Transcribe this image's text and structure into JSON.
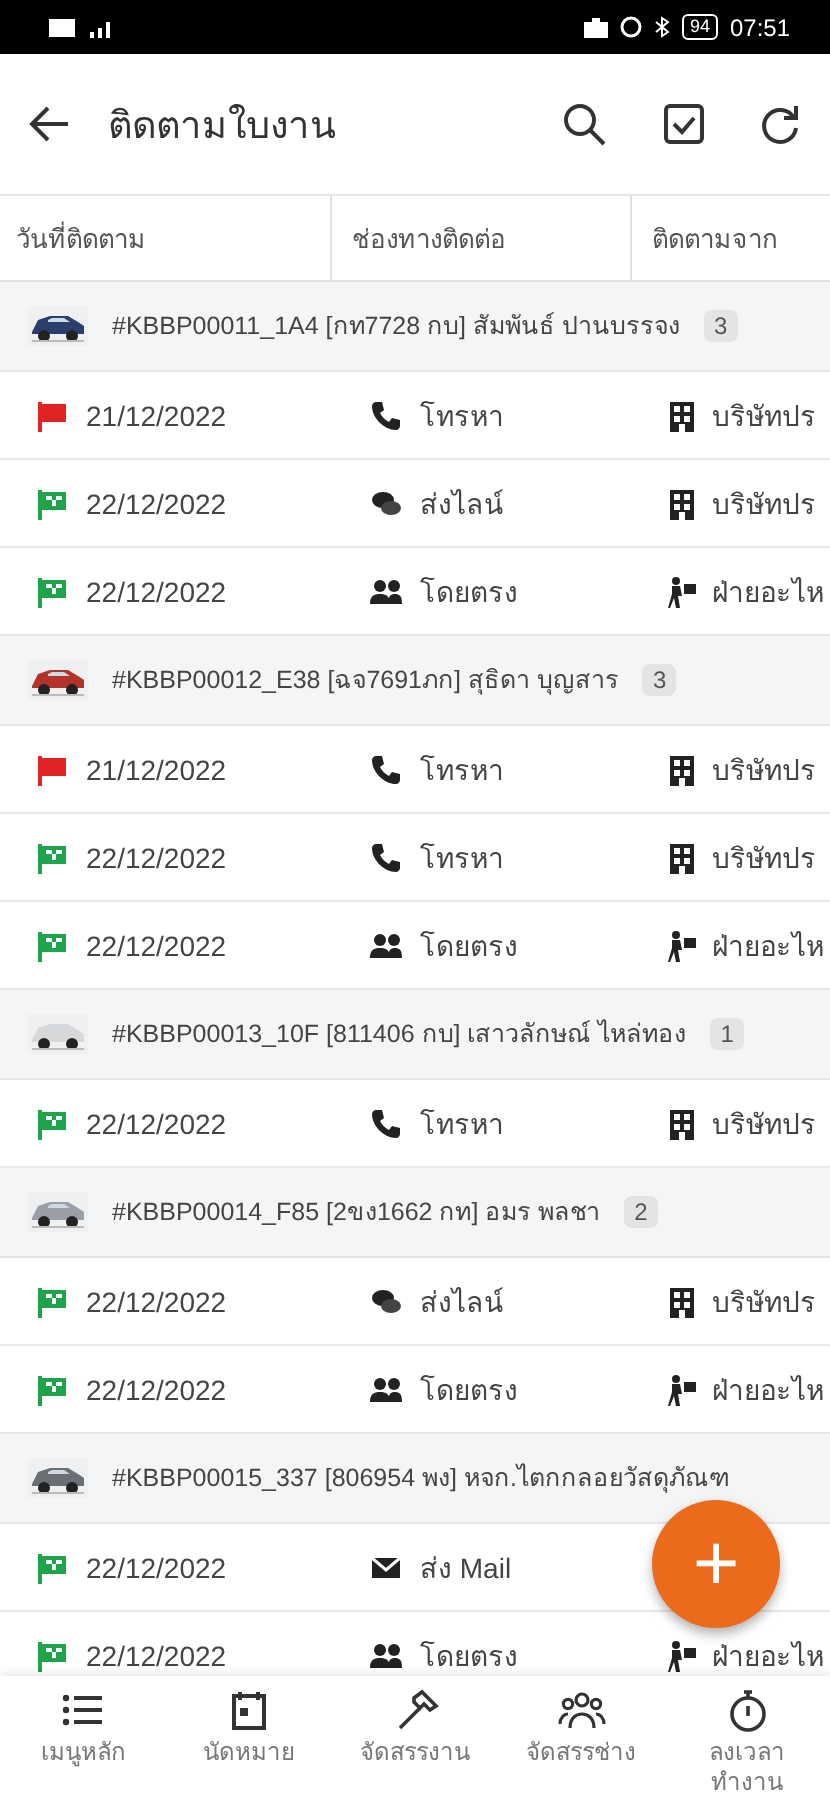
{
  "status_bar": {
    "battery": "94",
    "time": "07:51"
  },
  "app_bar": {
    "title": "ติดตามใบงาน"
  },
  "columns": [
    "วันที่ติดตาม",
    "ช่องทางติดต่อ",
    "ติดตามจาก"
  ],
  "groups": [
    {
      "title": "#KBBP00011_1A4 [กท7728 กบ] สัมพันธ์ ปานบรรจง",
      "count": "3",
      "items": [
        {
          "done": false,
          "date": "21/12/2022",
          "channel": {
            "kind": "phone",
            "text": "โทรหา"
          },
          "source": {
            "kind": "company",
            "text": "บริษัทปร"
          }
        },
        {
          "done": true,
          "date": "22/12/2022",
          "channel": {
            "kind": "chat",
            "text": "ส่งไลน์"
          },
          "source": {
            "kind": "company",
            "text": "บริษัทปร"
          }
        },
        {
          "done": true,
          "date": "22/12/2022",
          "channel": {
            "kind": "people",
            "text": "โดยตรง"
          },
          "source": {
            "kind": "parts",
            "text": "ฝ่ายอะไห"
          }
        }
      ]
    },
    {
      "title": "#KBBP00012_E38 [ฉจ7691ภก] สุธิดา บุญสาร",
      "count": "3",
      "items": [
        {
          "done": false,
          "date": "21/12/2022",
          "channel": {
            "kind": "phone",
            "text": "โทรหา"
          },
          "source": {
            "kind": "company",
            "text": "บริษัทปร"
          }
        },
        {
          "done": true,
          "date": "22/12/2022",
          "channel": {
            "kind": "phone",
            "text": "โทรหา"
          },
          "source": {
            "kind": "company",
            "text": "บริษัทปร"
          }
        },
        {
          "done": true,
          "date": "22/12/2022",
          "channel": {
            "kind": "people",
            "text": "โดยตรง"
          },
          "source": {
            "kind": "parts",
            "text": "ฝ่ายอะไห"
          }
        }
      ]
    },
    {
      "title": "#KBBP00013_10F [811406 กบ] เสาวลักษณ์ ไหล่ทอง",
      "count": "1",
      "items": [
        {
          "done": true,
          "date": "22/12/2022",
          "channel": {
            "kind": "phone",
            "text": "โทรหา"
          },
          "source": {
            "kind": "company",
            "text": "บริษัทปร"
          }
        }
      ]
    },
    {
      "title": "#KBBP00014_F85 [2ขง1662 กท] อมร พลชา",
      "count": "2",
      "items": [
        {
          "done": true,
          "date": "22/12/2022",
          "channel": {
            "kind": "chat",
            "text": "ส่งไลน์"
          },
          "source": {
            "kind": "company",
            "text": "บริษัทปร"
          }
        },
        {
          "done": true,
          "date": "22/12/2022",
          "channel": {
            "kind": "people",
            "text": "โดยตรง"
          },
          "source": {
            "kind": "parts",
            "text": "ฝ่ายอะไห"
          }
        }
      ]
    },
    {
      "title": "#KBBP00015_337 [806954 พง] หจก.ไตกกลอยวัสดุภัณฑ",
      "items": [
        {
          "done": true,
          "date": "22/12/2022",
          "channel": {
            "kind": "mail",
            "text": "ส่ง Mail"
          }
        },
        {
          "done": true,
          "date": "22/12/2022",
          "channel": {
            "kind": "people",
            "text": "โดยตรง"
          },
          "source": {
            "kind": "parts",
            "text": "ฝ่ายอะไห"
          }
        }
      ]
    }
  ],
  "fab": {
    "label": "+"
  },
  "nav": [
    {
      "kind": "list",
      "label": "เมนูหลัก"
    },
    {
      "kind": "calendar",
      "label": "นัดหมาย"
    },
    {
      "kind": "hammer",
      "label": "จัดสรรงาน"
    },
    {
      "kind": "team",
      "label": "จัดสรรช่าง"
    },
    {
      "kind": "timer",
      "label": "ลงเวลา\nทำงาน"
    }
  ]
}
